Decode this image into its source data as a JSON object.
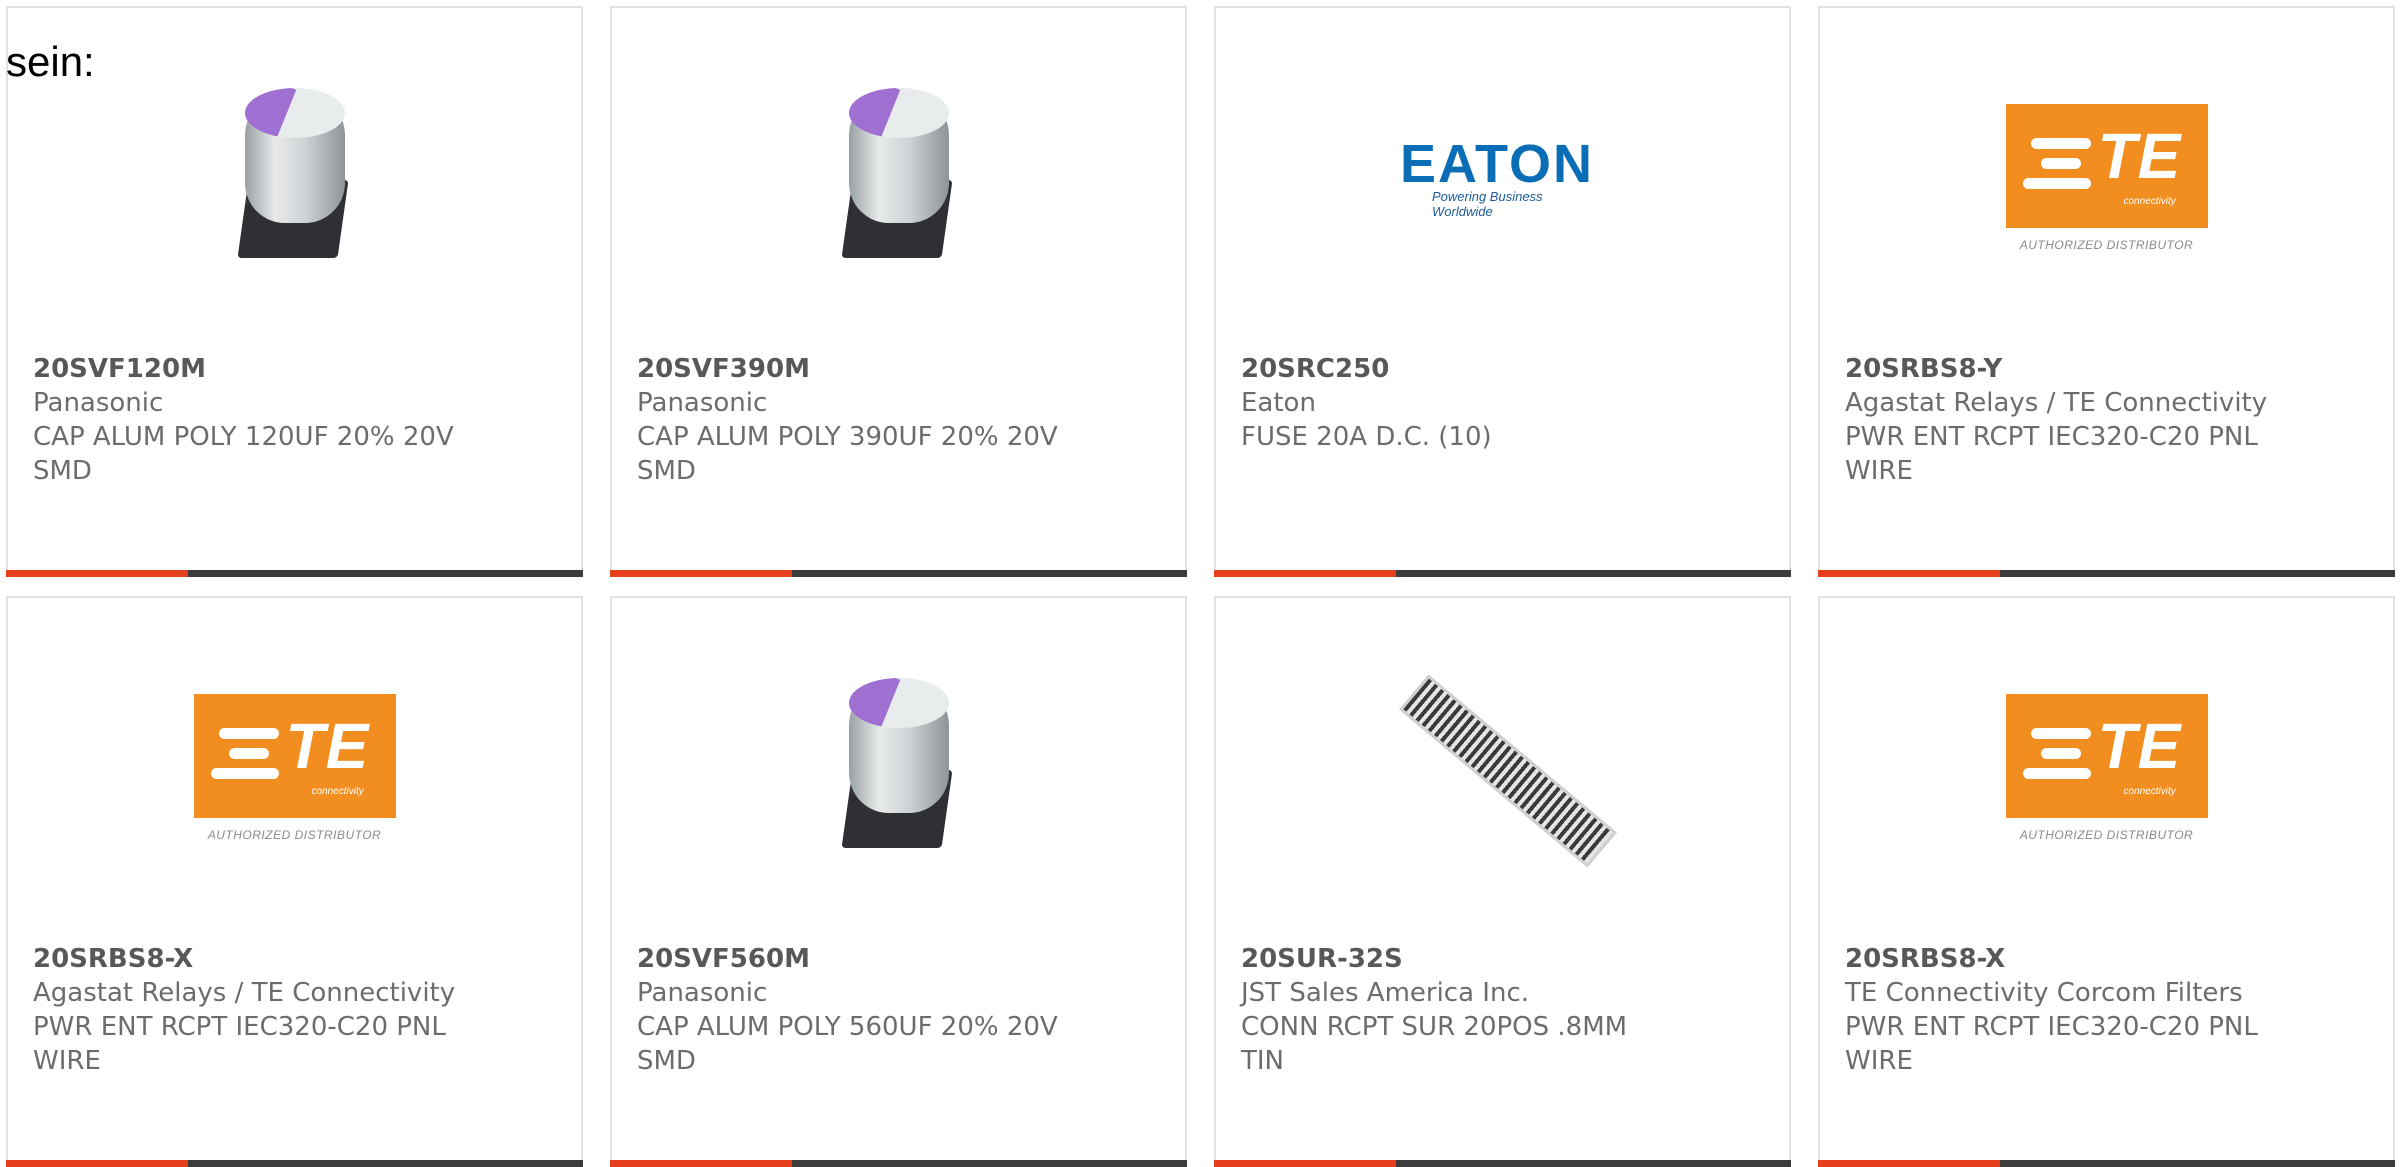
{
  "intro_text": "sein:",
  "cards": [
    {
      "part": "20SVF120M",
      "manufacturer": "Panasonic",
      "description": "CAP ALUM POLY 120UF 20% 20V\nSMD",
      "image": "capacitor"
    },
    {
      "part": "20SVF390M",
      "manufacturer": "Panasonic",
      "description": "CAP ALUM POLY 390UF 20% 20V\nSMD",
      "image": "capacitor"
    },
    {
      "part": "20SRC250",
      "manufacturer": "Eaton",
      "description": "FUSE 20A D.C. (10)",
      "image": "eaton-logo",
      "logo": {
        "word": "EATON",
        "tagline": "Powering Business Worldwide"
      }
    },
    {
      "part": "20SRBS8-Y",
      "manufacturer": "Agastat Relays / TE Connectivity",
      "description": "PWR ENT RCPT IEC320-C20 PNL\nWIRE",
      "image": "te-logo",
      "logo": {
        "word": "TE",
        "sub": "connectivity",
        "caption": "AUTHORIZED DISTRIBUTOR"
      }
    },
    {
      "part": "20SRBS8-X",
      "manufacturer": "Agastat Relays / TE Connectivity",
      "description": "PWR ENT RCPT IEC320-C20 PNL\nWIRE",
      "image": "te-logo",
      "logo": {
        "word": "TE",
        "sub": "connectivity",
        "caption": "AUTHORIZED DISTRIBUTOR"
      }
    },
    {
      "part": "20SVF560M",
      "manufacturer": "Panasonic",
      "description": "CAP ALUM POLY 560UF 20% 20V\nSMD",
      "image": "capacitor"
    },
    {
      "part": "20SUR-32S",
      "manufacturer": "JST Sales America Inc.",
      "description": "CONN RCPT SUR 20POS .8MM\nTIN",
      "image": "connector"
    },
    {
      "part": "20SRBS8-X",
      "manufacturer": "TE Connectivity Corcom Filters",
      "description": "PWR ENT RCPT IEC320-C20 PNL\nWIRE",
      "image": "te-logo",
      "logo": {
        "word": "TE",
        "sub": "connectivity",
        "caption": "AUTHORIZED DISTRIBUTOR"
      }
    }
  ],
  "colors": {
    "accent_bar": "#e53f1e",
    "bar": "#3c3c3c",
    "border": "#e1e1e1",
    "te_orange": "#f28e1f",
    "eaton_blue": "#0a6db5"
  }
}
